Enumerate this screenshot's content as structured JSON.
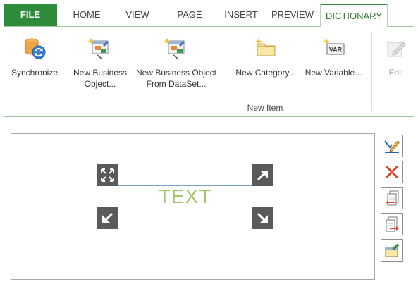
{
  "tabs": {
    "file": "FILE",
    "home": "HOME",
    "view": "VIEW",
    "page": "PAGE",
    "insert": "INSERT",
    "preview": "PREVIEW",
    "dictionary": "DICTIONARY",
    "active": "DICTIONARY"
  },
  "ribbon": {
    "synchronize": {
      "label": "Synchronize",
      "icon": "database-sync-icon"
    },
    "new_business_object": {
      "line1": "New Business",
      "line2": "Object...",
      "icon": "new-business-object-icon"
    },
    "new_business_object_from_dataset": {
      "line1": "New Business Object",
      "line2": "From DataSet...",
      "icon": "new-business-object-dataset-icon"
    },
    "new_category": {
      "label": "New Category...",
      "icon": "new-category-folder-icon"
    },
    "new_variable": {
      "label": "New Variable...",
      "icon": "new-variable-icon",
      "badge": "VAR"
    },
    "edit": {
      "label": "Edit",
      "icon": "edit-pencil-icon",
      "disabled": true
    },
    "group_label": "New Item"
  },
  "canvas": {
    "text_component": "TEXT",
    "handles": [
      "expand-icon",
      "arrow-up-right-icon",
      "arrow-down-left-icon",
      "arrow-down-right-icon"
    ]
  },
  "side_toolbar": [
    {
      "name": "edit-component-icon"
    },
    {
      "name": "delete-icon"
    },
    {
      "name": "copy-left-icon"
    },
    {
      "name": "copy-right-icon"
    },
    {
      "name": "properties-icon"
    }
  ],
  "colors": {
    "accent_green": "#2e8b3a",
    "text_green": "#a7c36b",
    "handle_gray": "#5a5a5a",
    "delete_red": "#d9452c"
  }
}
